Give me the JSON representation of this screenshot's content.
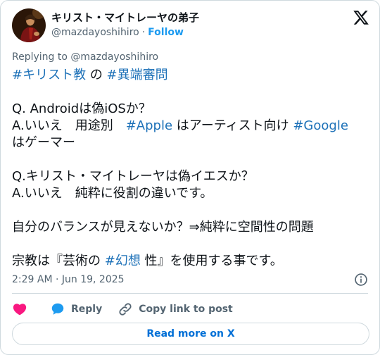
{
  "author": {
    "display_name": "キリスト・マイトレーヤの弟子",
    "handle": "@mazdayoshihiro",
    "separator": "·",
    "follow_label": "Follow"
  },
  "replying_to": "Replying to @mazdayoshihiro",
  "tweet": {
    "line1": {
      "tag1": "#キリスト教",
      "mid": " の ",
      "tag2": "#異端審問"
    },
    "line2": "Q. Androidは偽iOSか？",
    "line3": {
      "pre": "A.いいえ　用途別　",
      "tag1": "#Apple",
      "mid": " はアーティスト向け ",
      "tag2": "#Google"
    },
    "line4": "はゲーマー",
    "line5": "Q.キリスト・マイトレーヤは偽イエスか？",
    "line6": "A.いいえ　純粋に役割の違いです。",
    "line7": "自分のバランスが見えないか？⇒純粋に空間性の問題",
    "line8": {
      "pre": "宗教は『芸術の ",
      "tag": "#幻想",
      "post": " 性』を使用する事です。"
    }
  },
  "timestamp": "2:29 AM · Jun 19, 2025",
  "actions": {
    "like_icon": "heart-icon",
    "reply_icon": "speech-bubble-icon",
    "reply_label": "Reply",
    "copy_icon": "link-icon",
    "copy_label": "Copy link to post"
  },
  "read_more_label": "Read more on X",
  "colors": {
    "text": "#0f1419",
    "secondary": "#536471",
    "link": "#1d9bf0",
    "hashtag": "#1d71b8",
    "like": "#f91880",
    "border": "#cfd9de"
  }
}
